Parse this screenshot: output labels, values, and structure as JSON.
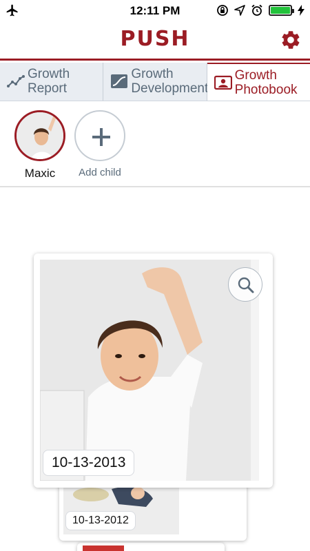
{
  "status_bar": {
    "time": "12:11 PM",
    "icons": [
      "airplane-icon",
      "rotation-lock-icon",
      "location-arrow-icon",
      "alarm-icon",
      "battery-icon",
      "charging-bolt-icon"
    ],
    "battery_level": 1.0,
    "battery_color": "#22c23b"
  },
  "header": {
    "title": "PUSH",
    "brand_color": "#9b1c24",
    "settings_icon": "gear-icon"
  },
  "tabs": [
    {
      "label": "Growth Report",
      "icon": "line-chart-icon",
      "active": false
    },
    {
      "label": "Growth Development",
      "icon": "curve-chart-icon",
      "active": false
    },
    {
      "label": "Growth Photobook",
      "icon": "photo-portrait-icon",
      "active": true
    }
  ],
  "children": {
    "items": [
      {
        "name": "Maxic",
        "selected": true
      }
    ],
    "add_label": "Add child",
    "add_icon": "plus-icon"
  },
  "photos": [
    {
      "date": "10-13-2013",
      "zoom_icon": "magnifier-icon"
    },
    {
      "date": "10-13-2012"
    },
    {
      "date": ""
    }
  ]
}
